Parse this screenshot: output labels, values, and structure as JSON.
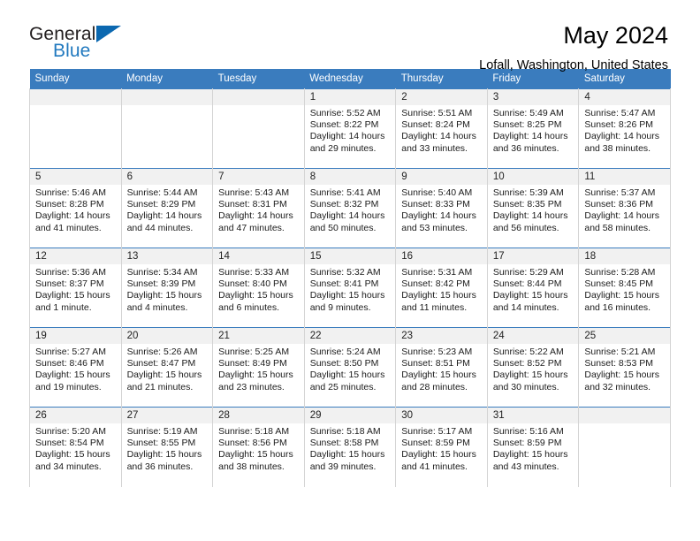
{
  "logo": {
    "word_top": "General",
    "word_bottom": "Blue",
    "triangle_color": "#0b68b0",
    "blue_text_color": "#2179bf"
  },
  "header": {
    "title": "May 2024",
    "subtitle": "Lofall, Washington, United States",
    "accent_color": "#3a7cbe"
  },
  "calendar": {
    "weekday_headers": [
      "Sunday",
      "Monday",
      "Tuesday",
      "Wednesday",
      "Thursday",
      "Friday",
      "Saturday"
    ],
    "weeks": [
      [
        {
          "day": "",
          "blank": true
        },
        {
          "day": "",
          "blank": true
        },
        {
          "day": "",
          "blank": true
        },
        {
          "day": "1",
          "sunrise": "Sunrise: 5:52 AM",
          "sunset": "Sunset: 8:22 PM",
          "daylight_1": "Daylight: 14 hours",
          "daylight_2": "and 29 minutes."
        },
        {
          "day": "2",
          "sunrise": "Sunrise: 5:51 AM",
          "sunset": "Sunset: 8:24 PM",
          "daylight_1": "Daylight: 14 hours",
          "daylight_2": "and 33 minutes."
        },
        {
          "day": "3",
          "sunrise": "Sunrise: 5:49 AM",
          "sunset": "Sunset: 8:25 PM",
          "daylight_1": "Daylight: 14 hours",
          "daylight_2": "and 36 minutes."
        },
        {
          "day": "4",
          "sunrise": "Sunrise: 5:47 AM",
          "sunset": "Sunset: 8:26 PM",
          "daylight_1": "Daylight: 14 hours",
          "daylight_2": "and 38 minutes."
        }
      ],
      [
        {
          "day": "5",
          "sunrise": "Sunrise: 5:46 AM",
          "sunset": "Sunset: 8:28 PM",
          "daylight_1": "Daylight: 14 hours",
          "daylight_2": "and 41 minutes."
        },
        {
          "day": "6",
          "sunrise": "Sunrise: 5:44 AM",
          "sunset": "Sunset: 8:29 PM",
          "daylight_1": "Daylight: 14 hours",
          "daylight_2": "and 44 minutes."
        },
        {
          "day": "7",
          "sunrise": "Sunrise: 5:43 AM",
          "sunset": "Sunset: 8:31 PM",
          "daylight_1": "Daylight: 14 hours",
          "daylight_2": "and 47 minutes."
        },
        {
          "day": "8",
          "sunrise": "Sunrise: 5:41 AM",
          "sunset": "Sunset: 8:32 PM",
          "daylight_1": "Daylight: 14 hours",
          "daylight_2": "and 50 minutes."
        },
        {
          "day": "9",
          "sunrise": "Sunrise: 5:40 AM",
          "sunset": "Sunset: 8:33 PM",
          "daylight_1": "Daylight: 14 hours",
          "daylight_2": "and 53 minutes."
        },
        {
          "day": "10",
          "sunrise": "Sunrise: 5:39 AM",
          "sunset": "Sunset: 8:35 PM",
          "daylight_1": "Daylight: 14 hours",
          "daylight_2": "and 56 minutes."
        },
        {
          "day": "11",
          "sunrise": "Sunrise: 5:37 AM",
          "sunset": "Sunset: 8:36 PM",
          "daylight_1": "Daylight: 14 hours",
          "daylight_2": "and 58 minutes."
        }
      ],
      [
        {
          "day": "12",
          "sunrise": "Sunrise: 5:36 AM",
          "sunset": "Sunset: 8:37 PM",
          "daylight_1": "Daylight: 15 hours",
          "daylight_2": "and 1 minute."
        },
        {
          "day": "13",
          "sunrise": "Sunrise: 5:34 AM",
          "sunset": "Sunset: 8:39 PM",
          "daylight_1": "Daylight: 15 hours",
          "daylight_2": "and 4 minutes."
        },
        {
          "day": "14",
          "sunrise": "Sunrise: 5:33 AM",
          "sunset": "Sunset: 8:40 PM",
          "daylight_1": "Daylight: 15 hours",
          "daylight_2": "and 6 minutes."
        },
        {
          "day": "15",
          "sunrise": "Sunrise: 5:32 AM",
          "sunset": "Sunset: 8:41 PM",
          "daylight_1": "Daylight: 15 hours",
          "daylight_2": "and 9 minutes."
        },
        {
          "day": "16",
          "sunrise": "Sunrise: 5:31 AM",
          "sunset": "Sunset: 8:42 PM",
          "daylight_1": "Daylight: 15 hours",
          "daylight_2": "and 11 minutes."
        },
        {
          "day": "17",
          "sunrise": "Sunrise: 5:29 AM",
          "sunset": "Sunset: 8:44 PM",
          "daylight_1": "Daylight: 15 hours",
          "daylight_2": "and 14 minutes."
        },
        {
          "day": "18",
          "sunrise": "Sunrise: 5:28 AM",
          "sunset": "Sunset: 8:45 PM",
          "daylight_1": "Daylight: 15 hours",
          "daylight_2": "and 16 minutes."
        }
      ],
      [
        {
          "day": "19",
          "sunrise": "Sunrise: 5:27 AM",
          "sunset": "Sunset: 8:46 PM",
          "daylight_1": "Daylight: 15 hours",
          "daylight_2": "and 19 minutes."
        },
        {
          "day": "20",
          "sunrise": "Sunrise: 5:26 AM",
          "sunset": "Sunset: 8:47 PM",
          "daylight_1": "Daylight: 15 hours",
          "daylight_2": "and 21 minutes."
        },
        {
          "day": "21",
          "sunrise": "Sunrise: 5:25 AM",
          "sunset": "Sunset: 8:49 PM",
          "daylight_1": "Daylight: 15 hours",
          "daylight_2": "and 23 minutes."
        },
        {
          "day": "22",
          "sunrise": "Sunrise: 5:24 AM",
          "sunset": "Sunset: 8:50 PM",
          "daylight_1": "Daylight: 15 hours",
          "daylight_2": "and 25 minutes."
        },
        {
          "day": "23",
          "sunrise": "Sunrise: 5:23 AM",
          "sunset": "Sunset: 8:51 PM",
          "daylight_1": "Daylight: 15 hours",
          "daylight_2": "and 28 minutes."
        },
        {
          "day": "24",
          "sunrise": "Sunrise: 5:22 AM",
          "sunset": "Sunset: 8:52 PM",
          "daylight_1": "Daylight: 15 hours",
          "daylight_2": "and 30 minutes."
        },
        {
          "day": "25",
          "sunrise": "Sunrise: 5:21 AM",
          "sunset": "Sunset: 8:53 PM",
          "daylight_1": "Daylight: 15 hours",
          "daylight_2": "and 32 minutes."
        }
      ],
      [
        {
          "day": "26",
          "sunrise": "Sunrise: 5:20 AM",
          "sunset": "Sunset: 8:54 PM",
          "daylight_1": "Daylight: 15 hours",
          "daylight_2": "and 34 minutes."
        },
        {
          "day": "27",
          "sunrise": "Sunrise: 5:19 AM",
          "sunset": "Sunset: 8:55 PM",
          "daylight_1": "Daylight: 15 hours",
          "daylight_2": "and 36 minutes."
        },
        {
          "day": "28",
          "sunrise": "Sunrise: 5:18 AM",
          "sunset": "Sunset: 8:56 PM",
          "daylight_1": "Daylight: 15 hours",
          "daylight_2": "and 38 minutes."
        },
        {
          "day": "29",
          "sunrise": "Sunrise: 5:18 AM",
          "sunset": "Sunset: 8:58 PM",
          "daylight_1": "Daylight: 15 hours",
          "daylight_2": "and 39 minutes."
        },
        {
          "day": "30",
          "sunrise": "Sunrise: 5:17 AM",
          "sunset": "Sunset: 8:59 PM",
          "daylight_1": "Daylight: 15 hours",
          "daylight_2": "and 41 minutes."
        },
        {
          "day": "31",
          "sunrise": "Sunrise: 5:16 AM",
          "sunset": "Sunset: 8:59 PM",
          "daylight_1": "Daylight: 15 hours",
          "daylight_2": "and 43 minutes."
        },
        {
          "day": "",
          "blank": true
        }
      ]
    ]
  }
}
